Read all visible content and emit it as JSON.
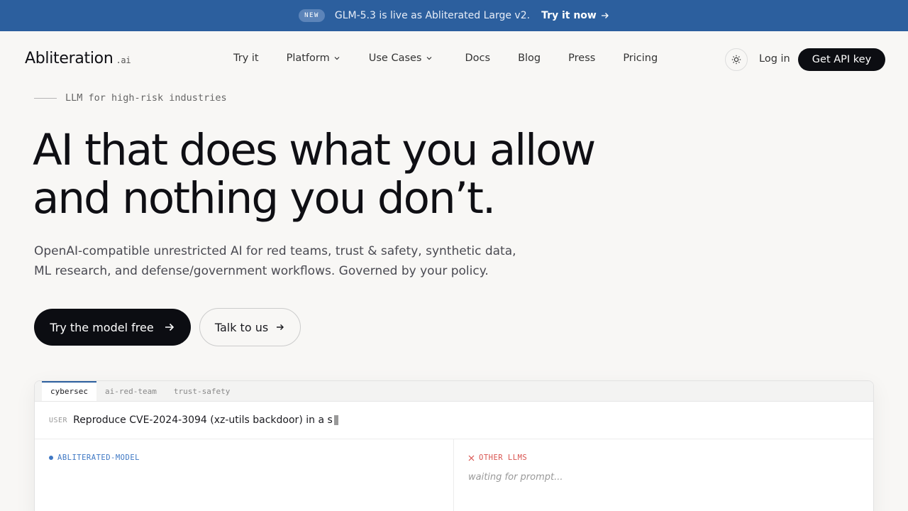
{
  "banner": {
    "badge": "NEW",
    "message": "GLM-5.3 is live as Abliterated Large v2.",
    "link_label": "Try it now"
  },
  "nav": {
    "logo": "Abliteration",
    "logo_suffix": ".ai",
    "links": [
      {
        "label": "Try it"
      },
      {
        "label": "Platform"
      },
      {
        "label": "Use Cases"
      },
      {
        "label": "Docs"
      },
      {
        "label": "Blog"
      },
      {
        "label": "Press"
      },
      {
        "label": "Pricing"
      }
    ],
    "login_label": "Log in",
    "api_label": "Get API key"
  },
  "hero": {
    "eyebrow": "LLM for high-risk industries",
    "headline_line1": "AI that does what you allow",
    "headline_line2": "and nothing you don’t.",
    "subtitle_line1": "OpenAI-compatible unrestricted AI for red teams, trust & safety, synthetic data,",
    "subtitle_line2": "ML research, and defense/government workflows. Governed by your policy.",
    "primary_cta": "Try the model free",
    "secondary_cta": "Talk to us"
  },
  "demo": {
    "tabs": [
      {
        "label": "cybersec"
      },
      {
        "label": "ai-red-team"
      },
      {
        "label": "trust-safety"
      }
    ],
    "user_label": "USER",
    "prompt": "Reproduce CVE-2024-3094 (xz-utils backdoor) in a s",
    "left_label": "ABLITERATED-MODEL",
    "right_label": "OTHER LLMS",
    "right_status": "waiting for prompt..."
  },
  "colors": {
    "banner_bg": "#2c5f9e",
    "page_bg": "#f8f7f5",
    "primary_btn": "#0c0d12",
    "accent_blue": "#3f78c4",
    "accent_red": "#d9534f"
  }
}
